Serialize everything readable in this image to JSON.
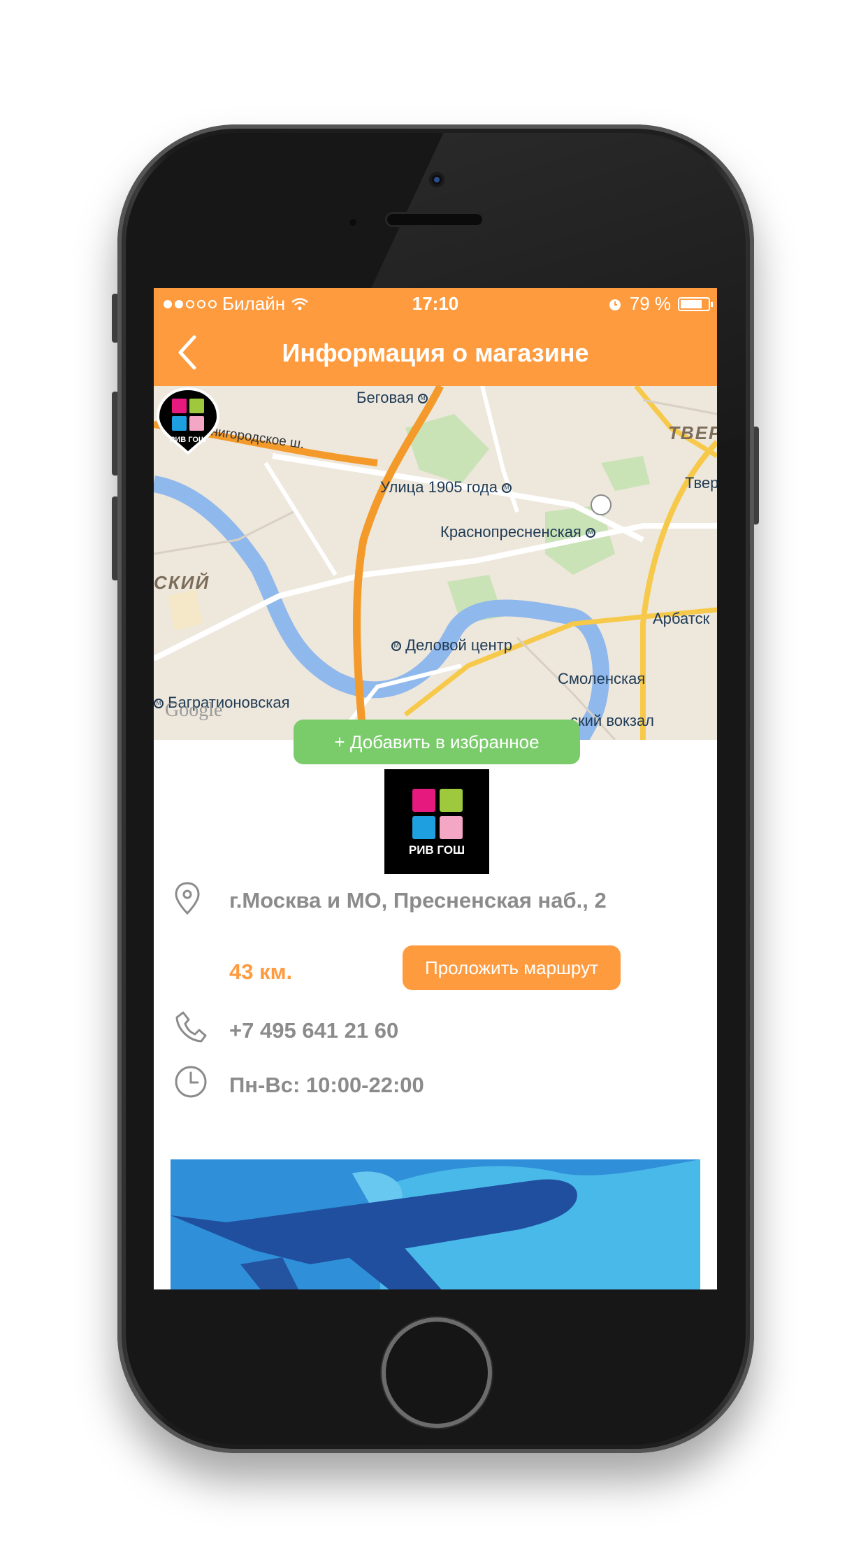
{
  "status_bar": {
    "carrier": "Билайн",
    "time": "17:10",
    "battery": "79 %",
    "battery_level": 0.79
  },
  "navbar": {
    "title": "Информация о магазине"
  },
  "map": {
    "labels": {
      "begovaya": "Беговая",
      "zvenigorodskoe": "Звенигородское ш.",
      "ulitsa_1905": "Улица 1905 года",
      "krasnopresnenskaya": "Краснопресненская",
      "delovoy_tsentr": "Деловой центр",
      "bagrationovskaya": "Багратионовская",
      "smolenskaya": "Смоленская",
      "arbatsk": "Арбатск",
      "tver_upper": "ТВЕР",
      "tver": "Твер",
      "district": "СКИЙ",
      "vokzal": "ский вокзал"
    },
    "attribution": "Google"
  },
  "favorite_button": "+ Добавить в избранное",
  "store": {
    "brand": "РИВ ГОШ",
    "address": "г.Москва и МО, Пресненская наб., 2",
    "distance": "43 км.",
    "route_button": "Проложить маршрут",
    "phone": "+7 495 641 21 60",
    "hours": "Пн-Вс: 10:00-22:00"
  },
  "colors": {
    "accent": "#ff9b3f",
    "favorite": "#7acc6b",
    "text_gray": "#8b8b8b",
    "logo_magenta": "#e6197f",
    "logo_green": "#9fc93c",
    "logo_blue": "#1ea0e0",
    "logo_pink": "#f4a7c4"
  }
}
